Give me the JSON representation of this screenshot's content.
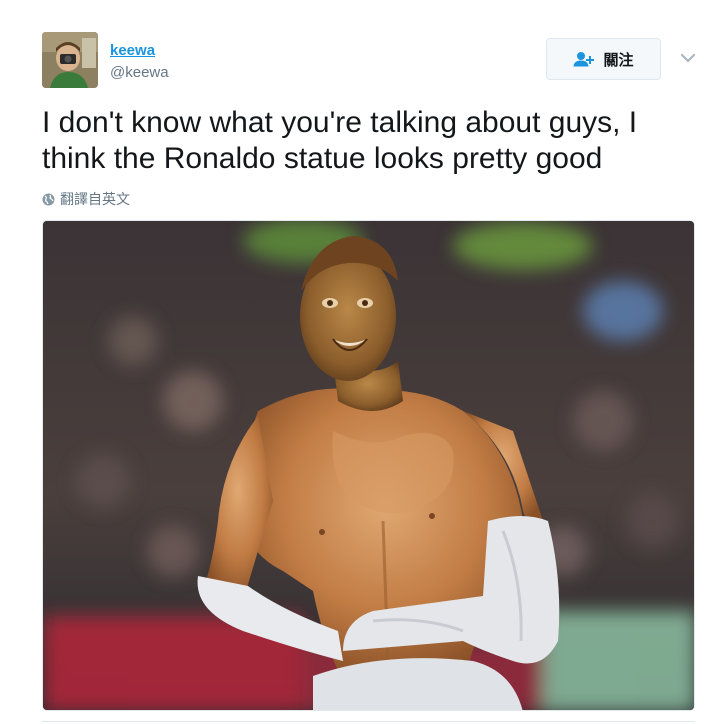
{
  "author": {
    "display_name": "keewa",
    "handle": "@keewa",
    "avatar_icon": "camera-photographer-avatar"
  },
  "actions": {
    "follow_label": "關注",
    "follow_icon": "add-user-icon",
    "more_icon": "chevron-down-icon"
  },
  "tweet": {
    "text": "I don't know what you're talking about guys, I think the Ronaldo statue looks pretty good",
    "translate_label": "翻譯自英文",
    "translate_icon": "globe-icon"
  },
  "media": {
    "type": "photo"
  },
  "colors": {
    "accent": "#1b95e0",
    "text": "#14171a",
    "muted": "#657786",
    "border": "#e1e8ed"
  }
}
